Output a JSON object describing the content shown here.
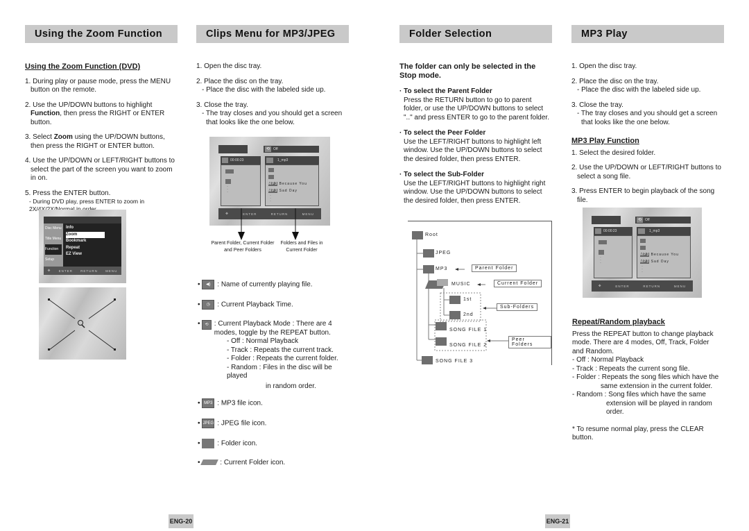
{
  "zoom": {
    "header": "Using the Zoom Function",
    "subtitle": "Using the Zoom Function (DVD)",
    "steps": [
      {
        "pre": "1. During play or pause mode, press the MENU button on the remote.",
        "bold": "",
        "post": ""
      },
      {
        "pre": "2. Use the UP/DOWN buttons to highlight ",
        "bold": "Function",
        "post": ", then press the RIGHT or ENTER button."
      },
      {
        "pre": "3. Select ",
        "bold": "Zoom",
        "post": " using the UP/DOWN buttons, then press the RIGHT or ENTER button."
      },
      {
        "pre": "4. Use the UP/DOWN or LEFT/RIGHT buttons to select the part of the screen you want to zoom in on.",
        "bold": "",
        "post": ""
      },
      {
        "pre": "5. Press the ENTER button.",
        "bold": "",
        "post": ""
      }
    ],
    "note": "- During DVD play, press ENTER to zoom in 2X/4X/2X/Normal in order.",
    "menu_screen": {
      "side_tabs": [
        "Disc Menu",
        "Title Menu",
        "Function",
        "Setup"
      ],
      "items": [
        "Info",
        "Zoom",
        "Bookmark",
        "Repeat",
        "EZ View"
      ],
      "selected": "Zoom",
      "bottom": [
        "ENTER",
        "RETURN",
        "MENU"
      ]
    }
  },
  "clips": {
    "header": "Clips Menu for MP3/JPEG",
    "steps": [
      "1. Open the disc tray.",
      "2. Place the disc on the tray.",
      "3. Close the tray."
    ],
    "step2_note": "- Place the disc with the labeled side up.",
    "step3_note": "- The tray closes and you should get a screen that looks like the one below.",
    "screen": {
      "mode": "Off",
      "time": "00:00:23",
      "file": "1_mp3",
      "songs": [
        "Because You",
        "Sad Day"
      ],
      "bottom": [
        "ENTER",
        "RETURN",
        "MENU"
      ]
    },
    "caption_left": "Parent Folder, Current Folder and Peer Folders",
    "caption_right": "Folders and Files in Current Folder",
    "legend": [
      {
        "icon": "speaker-icon",
        "text": ": Name of currently playing file."
      },
      {
        "icon": "clock-icon",
        "text": ": Current Playback Time."
      },
      {
        "icon": "repeat-icon",
        "text": ": Current Playback Mode : There are 4 modes, toggle by the REPEAT button."
      },
      {
        "icon": "mp3-file-icon",
        "text": ": MP3 file icon."
      },
      {
        "icon": "jpeg-file-icon",
        "text": ": JPEG file icon."
      },
      {
        "icon": "folder-icon",
        "text": ": Folder icon."
      },
      {
        "icon": "current-folder-icon",
        "text": ": Current Folder icon."
      }
    ],
    "modes": [
      "- Off : Normal Playback",
      "- Track : Repeats the current track.",
      "- Folder : Repeats the current folder.",
      "- Random : Files in the disc will be played",
      "in random order."
    ],
    "mp3_label": "MP3",
    "jpeg_label": "JPEG"
  },
  "folder": {
    "header": "Folder Selection",
    "intro": "The folder can only be selected in the Stop mode.",
    "sections": [
      {
        "title": "To select the Parent Folder",
        "body": "Press the RETURN button to go to parent folder, or use the UP/DOWN buttons to select \"..\" and press ENTER to go to the parent folder."
      },
      {
        "title": "To select the Peer Folder",
        "body": "Use the LEFT/RIGHT buttons to highlight left window. Use the UP/DOWN buttons to select the desired folder, then press ENTER."
      },
      {
        "title": "To select the Sub-Folder",
        "body": "Use the LEFT/RIGHT buttons to highlight right window. Use the UP/DOWN buttons to select the desired folder, then press ENTER."
      }
    ],
    "tree": {
      "nodes": [
        "Root",
        "JPEG",
        "MP3",
        "MUSIC",
        "1st",
        "2nd",
        "SONG FILE 1",
        "SONG FILE 2",
        "SONG FILE 3"
      ],
      "labels": [
        "Parent Folder",
        "Current Folder",
        "Sub-Folders",
        "Peer Folders"
      ]
    }
  },
  "mp3": {
    "header": "MP3 Play",
    "steps": [
      "1. Open the disc tray.",
      "2. Place the disc on the tray.",
      "3. Close the tray."
    ],
    "step2_note": "- Place the disc with the labeled side up.",
    "step3_note": "- The tray closes and you should get a screen that looks like the one below.",
    "func_title": "MP3 Play Function",
    "func_steps": [
      "1. Select the desired folder.",
      "2. Use the UP/DOWN or LEFT/RIGHT buttons to select a song file.",
      "3. Press ENTER to begin playback of the song file."
    ],
    "repeat_title": "Repeat/Random playback",
    "repeat_body": "Press the REPEAT button to change playback mode. There are 4 modes, Off, Track, Folder and Random.",
    "repeat_modes": [
      "- Off : Normal Playback",
      "- Track : Repeats the current song file.",
      "- Folder : Repeats the song files which have the",
      "same extension in the current folder.",
      "- Random : Song files which have the same",
      "extension will be played in random",
      "order."
    ],
    "clear_note": "* To resume normal play, press the CLEAR button."
  },
  "pages": {
    "left": "ENG-20",
    "right": "ENG-21"
  }
}
